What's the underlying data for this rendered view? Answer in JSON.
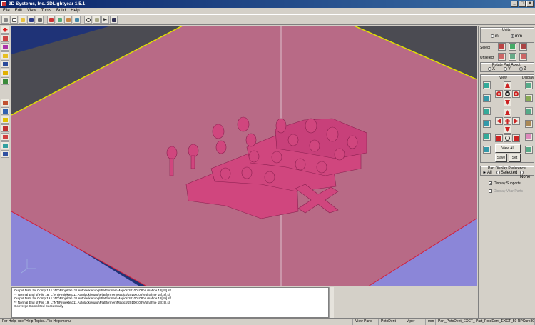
{
  "window": {
    "title": "3D Systems, Inc. 3DLightyear 1.5.1"
  },
  "menu": [
    "File",
    "Edit",
    "View",
    "Tools",
    "Build",
    "Help"
  ],
  "panel": {
    "units_title": "Units",
    "units_options": [
      "in",
      "mm"
    ],
    "select_label": "Select",
    "unselect_label": "Unselect",
    "rotate_title": "Rotate Part About",
    "rotate_options": [
      "X",
      "Y",
      "Z"
    ],
    "view_title": "View",
    "display_title": "Display",
    "view_all_label": "View All",
    "save_label": "Save",
    "set_label": "Set",
    "pref_title": "Part Display Preference",
    "pref_options": [
      "All",
      "Selected",
      "None"
    ],
    "display_supports_label": "Display Supports",
    "display_part_label": "Display Vitar Parts"
  },
  "log": [
    "Output Data for Comp 18 L:\\NT\\Projekte\\111 Autolackierung\\Plattformen\\Magics\\20100108\\Vulnahne 18[18].slf",
    "** Normal End of File 18, L:\\NT\\Projekte\\111 Autolackierung\\Plattformen\\Magics\\20100108\\Vulnahne 18[18].sli",
    "Output Data for Comp 19 L:\\NT\\Projekte\\111 Autolackierung\\Plattformen\\Magics\\20100108\\Vulnahne 18[19].slf",
    "** Normal End of File 19, L:\\NT\\Projekte\\111 Autolackierung\\Plattformen\\Magics\\20100108\\Vulnahne 18[19].sli",
    "Converge Completed Successfully"
  ],
  "status": {
    "help": "For Help, use \"Help Topics...\" in Help menu",
    "parts": "View Parts",
    "material": "PotoDent",
    "style": "Viper",
    "units": "mm",
    "file": "Part_PotoDent_EXCT_ Part_PotoDent_EXCT_50 RPCure300_3"
  },
  "colors": {
    "platform": "#b86a86",
    "floor": "#1f3377",
    "rail": "#4b4b52",
    "side": "#8b86d8",
    "part": "#d0467e"
  }
}
